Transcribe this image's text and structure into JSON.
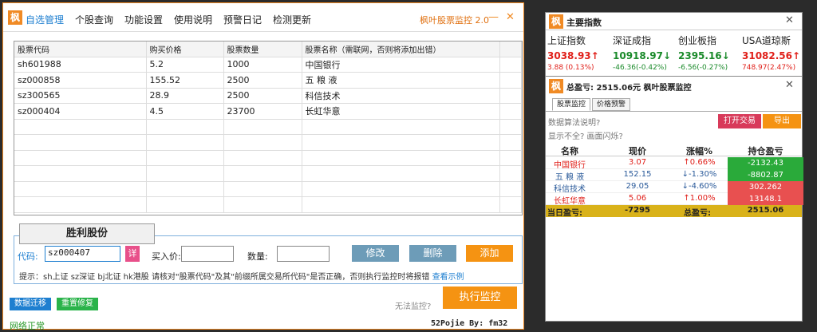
{
  "main": {
    "logo_char": "枫",
    "menu": [
      "自选管理",
      "个股查询",
      "功能设置",
      "使用说明",
      "预警日记",
      "检测更新"
    ],
    "title": "枫叶股票监控 2.0",
    "min": "—",
    "close": "✕",
    "grid": {
      "headers": [
        "股票代码",
        "购买价格",
        "股票数量",
        "股票名称（需联网，否则将添加出错）"
      ],
      "rows": [
        [
          "sh601988",
          "5.2",
          "1000",
          "中国银行"
        ],
        [
          "sz000858",
          "155.52",
          "2500",
          "五 粮 液"
        ],
        [
          "sz300565",
          "28.9",
          "2500",
          "科信技术"
        ],
        [
          "sz000404",
          "4.5",
          "23700",
          "长虹华意"
        ]
      ]
    },
    "group_tab": "胜利股份",
    "form": {
      "code_label": "代码:",
      "code_value": "sz000407",
      "detail_btn": "详",
      "price_label": "买入价:",
      "price_value": "",
      "qty_label": "数量:",
      "qty_value": "",
      "modify": "修改",
      "delete": "删除",
      "add": "添加"
    },
    "hint": "提示：sh上证 sz深证 bj北证 hk港股  请核对\"股票代码\"及其\"前缀所属交易所代码\"是否正确，否则执行监控时将报错",
    "hint_link": "查看示例",
    "migrate": "数据迁移",
    "repair": "重置修复",
    "cannot_monitor": "无法监控?",
    "run_monitor": "执行监控",
    "net_status": "网络正常",
    "credit": "52Pojie By: fm32"
  },
  "index_window": {
    "logo_char": "枫",
    "title": "主要指数",
    "close": "✕",
    "indices": [
      {
        "name": "上证指数",
        "value": "3038.93",
        "arrow": "↑",
        "change": "3.88 (0.13%)",
        "color": "#e0201a"
      },
      {
        "name": "深证成指",
        "value": "10918.97",
        "arrow": "↓",
        "change": "-46.36(-0.42%)",
        "color": "#1a8a2a"
      },
      {
        "name": "创业板指",
        "value": "2395.16",
        "arrow": "↓",
        "change": "-6.56(-0.27%)",
        "color": "#1a8a2a"
      },
      {
        "name": "USA道琼斯",
        "value": "31082.56",
        "arrow": "↑",
        "change": "748.97(2.47%)",
        "color": "#e0201a"
      }
    ]
  },
  "monitor_window": {
    "logo_char": "枫",
    "title_prefix": "总盈亏:",
    "title_amount": "2515.06元",
    "title_suffix": "枫叶股票监控",
    "close": "✕",
    "tabs": [
      "股票监控",
      "价格预警"
    ],
    "q1": "数据算法说明?",
    "q2": "显示不全? 画面闪烁?",
    "open_trade": "打开交易",
    "export": "导出",
    "headers": [
      "名称",
      "现价",
      "涨幅%",
      "持仓盈亏"
    ],
    "rows": [
      {
        "name": "中国银行",
        "price": "3.07",
        "arrow": "↑",
        "change": "0.66%",
        "pnl": "-2132.43",
        "up": true
      },
      {
        "name": "五 粮 液",
        "price": "152.15",
        "arrow": "↓",
        "change": "-1.30%",
        "pnl": "-8802.87",
        "up": false
      },
      {
        "name": "科信技术",
        "price": "29.05",
        "arrow": "↓",
        "change": "-4.60%",
        "pnl": "302.262",
        "up": false
      },
      {
        "name": "长虹华意",
        "price": "5.06",
        "arrow": "↑",
        "change": "1.00%",
        "pnl": "13148.1",
        "up": true
      }
    ],
    "summary": {
      "label1": "当日盈亏:",
      "value1": "-7295",
      "label2": "总盈亏:",
      "value2": "2515.06"
    }
  },
  "colors": {
    "accent": "#f08a24",
    "red": "#e0201a",
    "green": "#1a8a2a",
    "pnl_neg": "#2aaa3a",
    "pnl_pos": "#e85050",
    "summary": "#d9b21a"
  }
}
